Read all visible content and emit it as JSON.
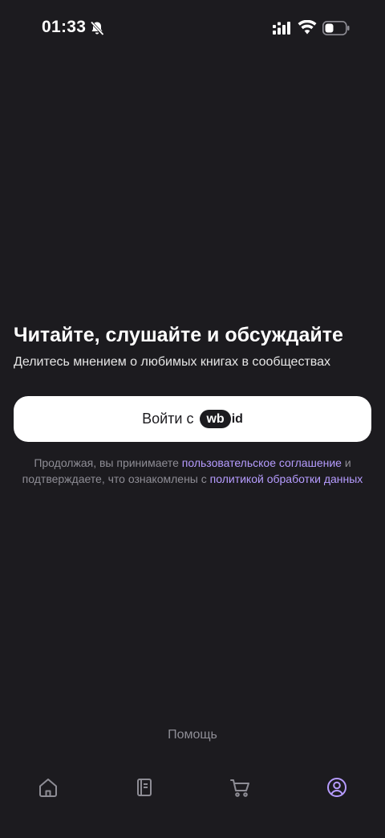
{
  "status_bar": {
    "time": "01:33",
    "icons": [
      "bell-off-icon",
      "signal-icon",
      "wifi-icon",
      "battery-icon"
    ]
  },
  "hero": {
    "title": "Читайте, слушайте и обсуждайте",
    "subtitle": "Делитесь мнением о любимых книгах в сообществах"
  },
  "login": {
    "label": "Войти с",
    "logo_wb": "wb",
    "logo_id": "id"
  },
  "legal": {
    "text1": "Продолжая, вы принимаете ",
    "link1": "пользовательское соглашение",
    "text2": " и подтверждаете, что ознакомлены с ",
    "link2": "политикой обработки данных"
  },
  "help": {
    "label": "Помощь"
  },
  "tab_bar": {
    "tabs": [
      {
        "icon": "home-icon",
        "active": false
      },
      {
        "icon": "book-icon",
        "active": false
      },
      {
        "icon": "cart-icon",
        "active": false
      },
      {
        "icon": "profile-icon",
        "active": true
      }
    ]
  },
  "colors": {
    "background": "#1c1b1f",
    "accent": "#b69cff",
    "muted": "#8e8d95",
    "button": "#ffffff"
  }
}
